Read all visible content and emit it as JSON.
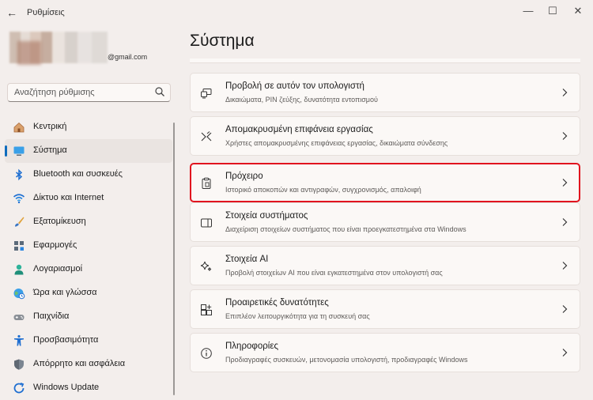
{
  "app": {
    "title": "Ρυθμίσεις",
    "back_glyph": "←"
  },
  "window_controls": {
    "minimize": "—",
    "maximize": "☐",
    "close": "✕"
  },
  "profile": {
    "email": "@gmail.com"
  },
  "search": {
    "placeholder": "Αναζήτηση ρύθμισης"
  },
  "nav": {
    "items": [
      {
        "label": "Κεντρική",
        "icon": "home-icon"
      },
      {
        "label": "Σύστημα",
        "icon": "system-icon",
        "active": true
      },
      {
        "label": "Bluetooth και συσκευές",
        "icon": "bluetooth-icon"
      },
      {
        "label": "Δίκτυο και Internet",
        "icon": "wifi-icon"
      },
      {
        "label": "Εξατομίκευση",
        "icon": "brush-icon"
      },
      {
        "label": "Εφαρμογές",
        "icon": "apps-icon"
      },
      {
        "label": "Λογαριασμοί",
        "icon": "account-icon"
      },
      {
        "label": "Ώρα και γλώσσα",
        "icon": "globe-clock-icon"
      },
      {
        "label": "Παιχνίδια",
        "icon": "gamepad-icon"
      },
      {
        "label": "Προσβασιμότητα",
        "icon": "accessibility-icon"
      },
      {
        "label": "Απόρρητο και ασφάλεια",
        "icon": "shield-icon"
      },
      {
        "label": "Windows Update",
        "icon": "update-icon"
      }
    ]
  },
  "main": {
    "title": "Σύστημα",
    "cards": [
      {
        "title": "Προβολή σε αυτόν τον υπολογιστή",
        "subtitle": "Δικαιώματα, PIN ζεύξης, δυνατότητα εντοπισμού",
        "icon": "project-icon"
      },
      {
        "title": "Απομακρυσμένη επιφάνεια εργασίας",
        "subtitle": "Χρήστες απομακρυσμένης επιφάνειας εργασίας, δικαιώματα σύνδεσης",
        "icon": "remote-desktop-icon"
      },
      {
        "title": "Πρόχειρο",
        "subtitle": "Ιστορικό αποκοπών και αντιγραφών, συγχρονισμός, απαλοιφή",
        "icon": "clipboard-icon",
        "highlighted": true
      },
      {
        "title": "Στοιχεία συστήματος",
        "subtitle": "Διαχείριση στοιχείων συστήματος που είναι προεγκατεστημένα στα Windows",
        "icon": "components-icon"
      },
      {
        "title": "Στοιχεία AI",
        "subtitle": "Προβολή στοιχείων AI που είναι εγκατεστημένα στον υπολογιστή σας",
        "icon": "sparkle-icon"
      },
      {
        "title": "Προαιρετικές δυνατότητες",
        "subtitle": "Επιπλέον λειτουργικότητα για τη συσκευή σας",
        "icon": "optional-features-icon"
      },
      {
        "title": "Πληροφορίες",
        "subtitle": "Προδιαγραφές συσκευών, μετονομασία υπολογιστή, προδιαγραφές Windows",
        "icon": "info-icon"
      }
    ]
  },
  "colors": {
    "accent": "#0f6cbd",
    "highlight_border": "#e1141f",
    "background": "#f3eeec",
    "card": "#fbf8f6"
  }
}
